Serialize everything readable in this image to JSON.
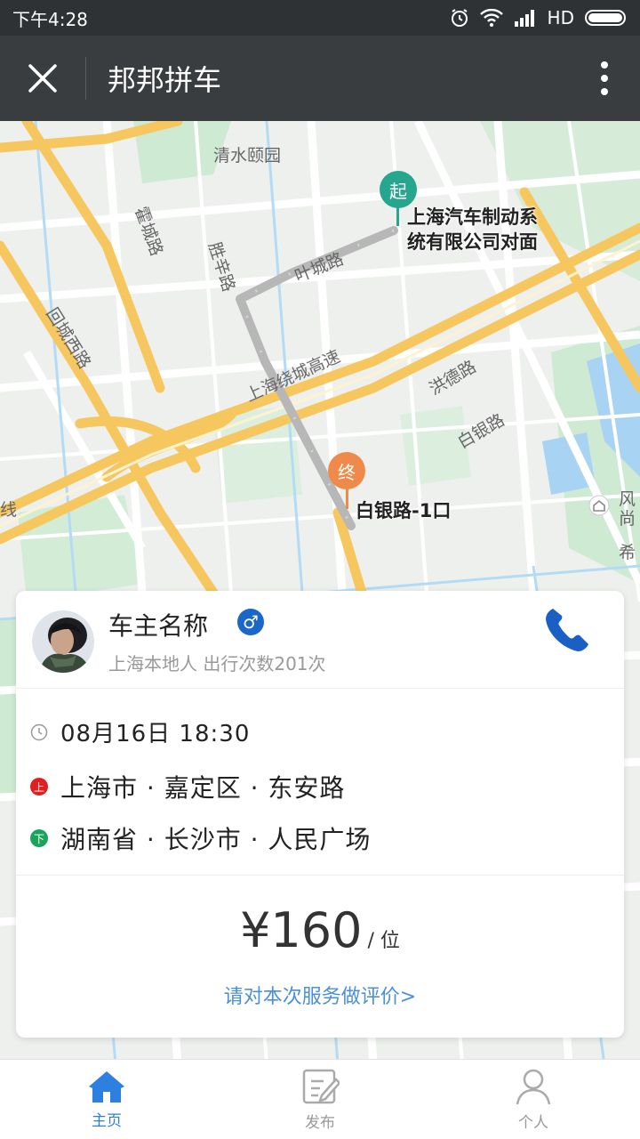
{
  "status_bar": {
    "time": "下午4:28",
    "network": "HD"
  },
  "title_bar": {
    "title": "邦邦拼车",
    "close_icon": "close-icon",
    "more_icon": "more-vertical-icon"
  },
  "map": {
    "labels": {
      "park": "清水颐园",
      "road_huocheng": "霍城路",
      "road_huicheng_west": "回城西路",
      "road_shengxin": "胜辛路",
      "road_xuzhu": "叶城路",
      "expressway": "上海绕城高速",
      "road_hongde": "洪德路",
      "road_baiyin": "白银路",
      "edge_left": "线",
      "edge_right_a": "风",
      "edge_right_b": "尚",
      "edge_right_c": "希"
    },
    "start_pin": {
      "label": "起",
      "name_line1": "上海汽车制动系",
      "name_line2": "统有限公司对面",
      "color": "#26a68f"
    },
    "end_pin": {
      "label": "终",
      "name": "白银路-1口",
      "color": "#f08a4b"
    }
  },
  "driver": {
    "name": "车主名称",
    "gender_symbol": "♂",
    "meta": "上海本地人  出行次数201次",
    "phone_icon": "phone-icon"
  },
  "trip": {
    "time": "08月16日  18:30",
    "from_badge": "上",
    "from": "上海市 · 嘉定区 · 东安路",
    "to_badge": "下",
    "to": "湖南省 · 长沙市 · 人民广场"
  },
  "price": {
    "amount": "¥160",
    "unit": "/ 位",
    "rate_link": "请对本次服务做评价>"
  },
  "tabs": [
    {
      "label": "主页",
      "icon": "home-icon",
      "active": true
    },
    {
      "label": "发布",
      "icon": "edit-icon",
      "active": false
    },
    {
      "label": "个人",
      "icon": "person-icon",
      "active": false
    }
  ],
  "colors": {
    "accent": "#2d7fe0",
    "link": "#4a90d9",
    "from_dot": "#e02020",
    "to_dot": "#1aa35b"
  }
}
